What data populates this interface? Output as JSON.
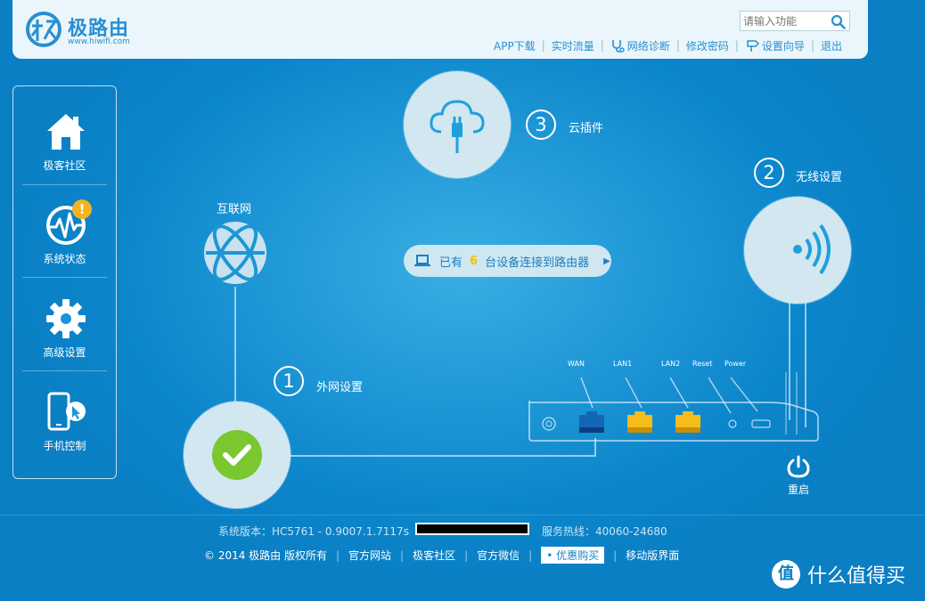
{
  "header": {
    "logo_title": "极路由",
    "logo_url": "www.hiwifi.com",
    "search_placeholder": "请输入功能",
    "nav": [
      "APP下载",
      "实时流量",
      "网络诊断",
      "修改密码",
      "设置向导",
      "退出"
    ]
  },
  "sidebar": {
    "items": [
      {
        "label": "极客社区",
        "icon": "home-icon"
      },
      {
        "label": "系统状态",
        "icon": "pulse-globe-icon",
        "badge": "!"
      },
      {
        "label": "高级设置",
        "icon": "gear-icon"
      },
      {
        "label": "手机控制",
        "icon": "phone-cursor-icon"
      }
    ]
  },
  "main": {
    "internet_label": "互联网",
    "step1": {
      "num": "1",
      "label": "外网设置"
    },
    "step2": {
      "num": "2",
      "label": "无线设置"
    },
    "step3": {
      "num": "3",
      "label": "云插件"
    },
    "connected": {
      "prefix": "已有",
      "count": "6",
      "suffix": "台设备连接到路由器",
      "arrow": "▶"
    },
    "router_ports": [
      "WAN",
      "LAN1",
      "LAN2",
      "Reset",
      "Power"
    ],
    "reboot_label": "重启"
  },
  "footer": {
    "version": "系统版本：HC5761 - 0.9007.1.7117s",
    "hotline": "服务热线：40060-24680",
    "copyright": "© 2014 极路由 版权所有",
    "links": [
      "官方网站",
      "极客社区",
      "官方微信"
    ],
    "buy": "优惠购买",
    "mobile": "移动版界面"
  },
  "watermark": {
    "text": "什么值得买",
    "glyph": "值"
  },
  "colors": {
    "bg": "#0c86cb",
    "accent": "#2a8fd0",
    "wan_port": "#1565b5",
    "lan_port": "#f4bd1a",
    "check": "#7ac72f",
    "badge": "#f5b31d"
  }
}
